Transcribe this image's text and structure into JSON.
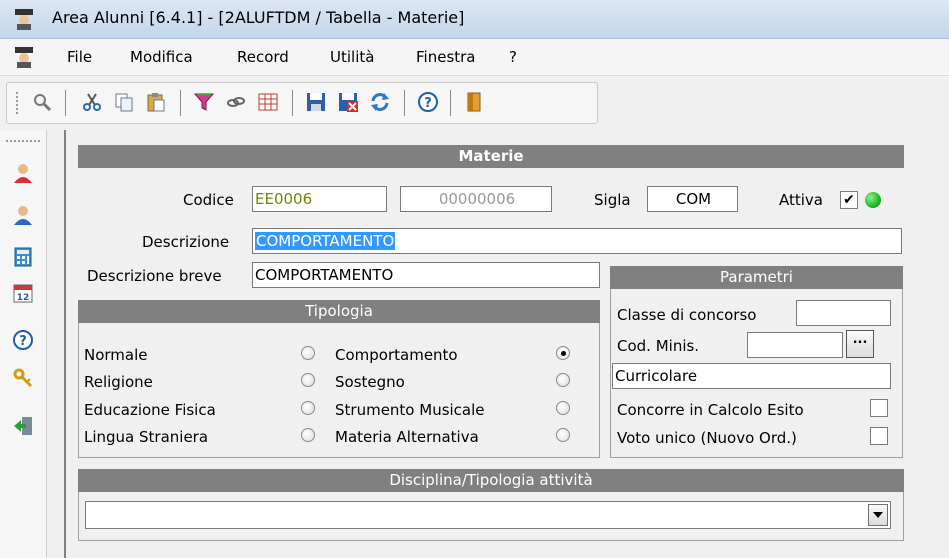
{
  "window": {
    "title": "Area Alunni [6.4.1] - [2ALUFTDM / Tabella - Materie]"
  },
  "menu": {
    "items": [
      "File",
      "Modifica",
      "Record",
      "Utilità",
      "Finestra",
      "?"
    ]
  },
  "toolbar": {
    "icons": [
      "search-icon",
      "cut-icon",
      "copy-icon",
      "paste-icon",
      "filter-icon",
      "link-icon",
      "grid-icon",
      "save-icon",
      "delete-save-icon",
      "refresh-icon",
      "help-icon",
      "exit-icon"
    ]
  },
  "sidebar": {
    "icons": [
      "user-red-icon",
      "user-blue-icon",
      "calculator-icon",
      "calendar-icon",
      "help-icon",
      "key-icon",
      "exit-icon"
    ],
    "calendar_number": "12"
  },
  "form": {
    "header": "Materie",
    "codice_label": "Codice",
    "codice_value": "EE0006",
    "codice_num": "00000006",
    "sigla_label": "Sigla",
    "sigla_value": "COM",
    "attiva_label": "Attiva",
    "attiva_checked": "✔",
    "descrizione_label": "Descrizione",
    "descrizione_value": "COMPORTAMENTO",
    "descr_breve_label": "Descrizione breve",
    "descr_breve_value": "COMPORTAMENTO"
  },
  "tipologia": {
    "header": "Tipologia",
    "left": [
      "Normale",
      "Religione",
      "Educazione Fisica",
      "Lingua Straniera"
    ],
    "right": [
      "Comportamento",
      "Sostegno",
      "Strumento Musicale",
      "Materia Alternativa"
    ],
    "selected": "Comportamento"
  },
  "parametri": {
    "header": "Parametri",
    "classe_label": "Classe di concorso",
    "classe_value": "",
    "codminis_label": "Cod. Minis.",
    "codminis_value": "",
    "codminis_button": "...",
    "curricolare_value": "Curricolare",
    "concorre_label": "Concorre in Calcolo Esito",
    "voto_label": "Voto unico (Nuovo Ord.)"
  },
  "disciplina": {
    "header": "Disciplina/Tipologia attività",
    "value": ""
  },
  "colors": {
    "header_bg": "#808080",
    "selection": "#3399ff",
    "status_green": "#22b822",
    "code_text": "#6a8a00"
  }
}
